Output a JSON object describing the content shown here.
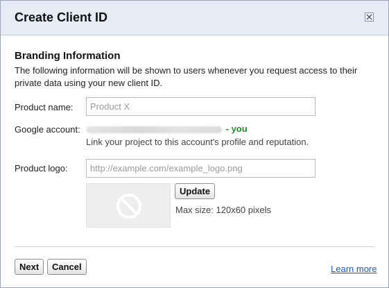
{
  "dialog": {
    "title": "Create Client ID",
    "close_icon": "close-icon"
  },
  "branding": {
    "heading": "Branding Information",
    "description": "The following information will be shown to users whenever you request access to their private data using your new client ID."
  },
  "product_name": {
    "label": "Product name:",
    "value": "",
    "placeholder": "Product X"
  },
  "google_account": {
    "label": "Google account:",
    "you_suffix": "- you",
    "hint": "Link your project to this account's profile and reputation."
  },
  "product_logo": {
    "label": "Product logo:",
    "value": "",
    "placeholder": "http://example.com/example_logo.png",
    "preview_icon": "no-image-icon",
    "update_label": "Update",
    "max_size": "Max size: 120x60 pixels"
  },
  "footer": {
    "next_label": "Next",
    "cancel_label": "Cancel",
    "learn_more": "Learn more"
  },
  "colors": {
    "titlebar_bg": "#e6ebf5",
    "you_green": "#2b8a2b",
    "link_blue": "#1a55c5"
  }
}
